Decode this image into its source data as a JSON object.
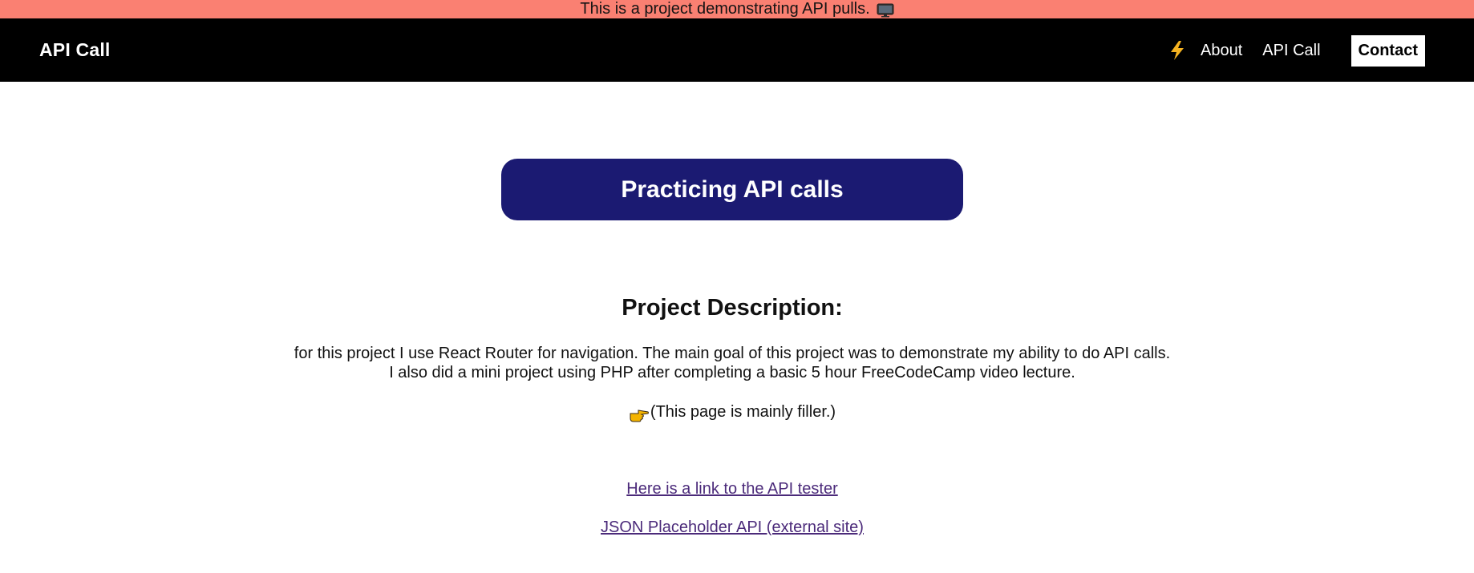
{
  "banner": {
    "text": "This is a project demonstrating API pulls.",
    "icon": "monitor-icon",
    "background": "#fa8072"
  },
  "navbar": {
    "brand": "API Call",
    "links": [
      {
        "label": "About",
        "icon": "lightning-bolt-icon"
      },
      {
        "label": "API Call"
      },
      {
        "label": "Contact",
        "style": "highlighted"
      }
    ],
    "background": "#000000"
  },
  "hero": {
    "title": "Practicing API calls",
    "background": "#1b1a72"
  },
  "description": {
    "heading": "Project Description:",
    "line1": "for this project I use React Router for navigation. The main goal of this project was to demonstrate my ability to do API calls.",
    "line2": "I also did a mini project using PHP after completing a basic 5 hour FreeCodeCamp video lecture.",
    "filler_icon": "pointing-hand-icon",
    "filler": "(This page is mainly filler.)"
  },
  "links": {
    "api_tester": "Here is a link to the API tester",
    "json_placeholder": "JSON Placeholder API (external site)",
    "color": "#4b2a7a"
  }
}
